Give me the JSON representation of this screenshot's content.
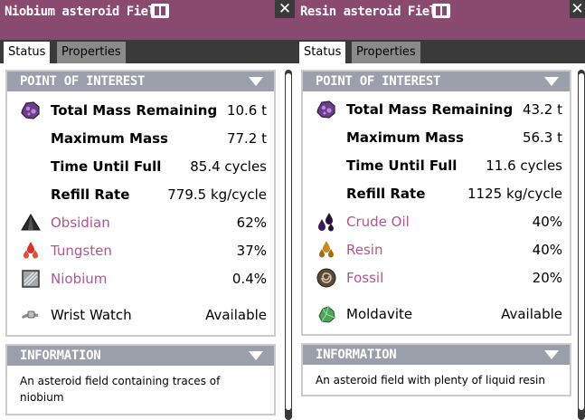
{
  "panels": [
    {
      "title": "Niobium asteroid Field",
      "tabs": [
        {
          "label": "Status"
        },
        {
          "label": "Properties"
        }
      ],
      "poi": {
        "header": "POINT OF INTEREST",
        "rows": [
          {
            "label": "Total Mass Remaining",
            "value": "10.6 t",
            "icon": "asteroid-icon"
          },
          {
            "label": "Maximum Mass",
            "value": "77.2 t"
          },
          {
            "label": "Time Until Full",
            "value": "85.4 cycles"
          },
          {
            "label": "Refill Rate",
            "value": "779.5 kg/cycle"
          },
          {
            "label": "Obsidian",
            "value": "62%",
            "icon": "obsidian-icon"
          },
          {
            "label": "Tungsten",
            "value": "37%",
            "icon": "tungsten-icon"
          },
          {
            "label": "Niobium",
            "value": "0.4%",
            "icon": "niobium-icon"
          },
          {
            "label": "Wrist Watch",
            "value": "Available",
            "icon": "wrist-watch-icon"
          }
        ]
      },
      "information": {
        "header": "INFORMATION",
        "text": "An asteroid field containing traces of niobium"
      }
    },
    {
      "title": "Resin asteroid Field",
      "tabs": [
        {
          "label": "Status"
        },
        {
          "label": "Properties"
        }
      ],
      "poi": {
        "header": "POINT OF INTEREST",
        "rows": [
          {
            "label": "Total Mass Remaining",
            "value": "43.2 t",
            "icon": "asteroid-icon"
          },
          {
            "label": "Maximum Mass",
            "value": "56.3 t"
          },
          {
            "label": "Time Until Full",
            "value": "11.6 cycles"
          },
          {
            "label": "Refill Rate",
            "value": "1125 kg/cycle"
          },
          {
            "label": "Crude Oil",
            "value": "40%",
            "icon": "crude-oil-icon"
          },
          {
            "label": "Resin",
            "value": "40%",
            "icon": "resin-icon"
          },
          {
            "label": "Fossil",
            "value": "20%",
            "icon": "fossil-icon"
          },
          {
            "label": "Moldavite",
            "value": "Available",
            "icon": "moldavite-icon"
          }
        ]
      },
      "information": {
        "header": "INFORMATION",
        "text": "An asteroid field with plenty of liquid resin"
      }
    }
  ],
  "close_symbol": "✕",
  "colors": {
    "titlebar": "#8a4a6f",
    "tabbar": "#3a3a3a",
    "section_header": "#9b9fa9",
    "element_link": "#b1568e"
  }
}
